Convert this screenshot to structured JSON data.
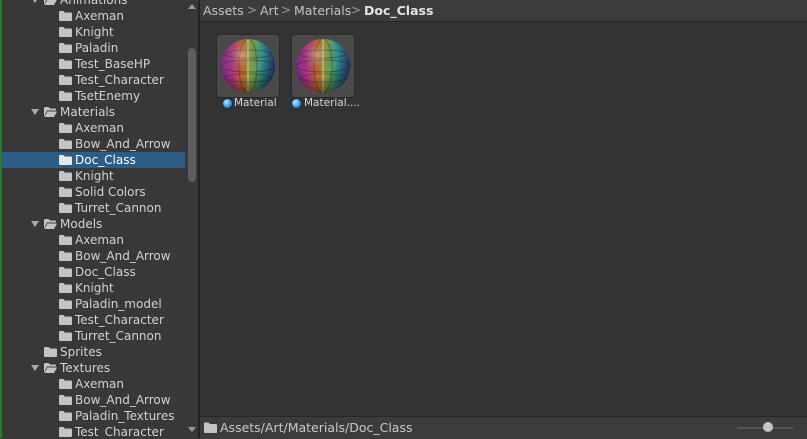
{
  "tree": {
    "rows": [
      {
        "label": "Animations",
        "depth": 0,
        "expanded": true,
        "selected": false
      },
      {
        "label": "Axeman",
        "depth": 1,
        "expanded": false,
        "selected": false
      },
      {
        "label": "Knight",
        "depth": 1,
        "expanded": false,
        "selected": false
      },
      {
        "label": "Paladin",
        "depth": 1,
        "expanded": false,
        "selected": false
      },
      {
        "label": "Test_BaseHP",
        "depth": 1,
        "expanded": false,
        "selected": false
      },
      {
        "label": "Test_Character",
        "depth": 1,
        "expanded": false,
        "selected": false
      },
      {
        "label": "TsetEnemy",
        "depth": 1,
        "expanded": false,
        "selected": false
      },
      {
        "label": "Materials",
        "depth": 0,
        "expanded": true,
        "selected": false
      },
      {
        "label": "Axeman",
        "depth": 1,
        "expanded": false,
        "selected": false
      },
      {
        "label": "Bow_And_Arrow",
        "depth": 1,
        "expanded": false,
        "selected": false
      },
      {
        "label": "Doc_Class",
        "depth": 1,
        "expanded": false,
        "selected": true
      },
      {
        "label": "Knight",
        "depth": 1,
        "expanded": false,
        "selected": false
      },
      {
        "label": "Solid Colors",
        "depth": 1,
        "expanded": false,
        "selected": false
      },
      {
        "label": "Turret_Cannon",
        "depth": 1,
        "expanded": false,
        "selected": false
      },
      {
        "label": "Models",
        "depth": 0,
        "expanded": true,
        "selected": false
      },
      {
        "label": "Axeman",
        "depth": 1,
        "expanded": false,
        "selected": false
      },
      {
        "label": "Bow_And_Arrow",
        "depth": 1,
        "expanded": false,
        "selected": false
      },
      {
        "label": "Doc_Class",
        "depth": 1,
        "expanded": false,
        "selected": false
      },
      {
        "label": "Knight",
        "depth": 1,
        "expanded": false,
        "selected": false
      },
      {
        "label": "Paladin_model",
        "depth": 1,
        "expanded": false,
        "selected": false
      },
      {
        "label": "Test_Character",
        "depth": 1,
        "expanded": false,
        "selected": false
      },
      {
        "label": "Turret_Cannon",
        "depth": 1,
        "expanded": false,
        "selected": false
      },
      {
        "label": "Sprites",
        "depth": 0,
        "expanded": false,
        "selected": false,
        "leaf": true
      },
      {
        "label": "Textures",
        "depth": 0,
        "expanded": true,
        "selected": false
      },
      {
        "label": "Axeman",
        "depth": 1,
        "expanded": false,
        "selected": false
      },
      {
        "label": "Bow_And_Arrow",
        "depth": 1,
        "expanded": false,
        "selected": false
      },
      {
        "label": "Paladin_Textures",
        "depth": 1,
        "expanded": false,
        "selected": false
      },
      {
        "label": "Test_Character",
        "depth": 1,
        "expanded": false,
        "selected": false
      }
    ]
  },
  "breadcrumb": {
    "items": [
      "Assets",
      "Art",
      "Materials",
      "Doc_Class"
    ],
    "separator": ">"
  },
  "assets": [
    {
      "label": "Material",
      "icon": "material-sphere-icon"
    },
    {
      "label": "Material....",
      "icon": "material-sphere-icon"
    }
  ],
  "footer": {
    "path": "Assets/Art/Materials/Doc_Class",
    "zoom_level": 0.5
  },
  "colors": {
    "selection": "#2c5d87",
    "background": "#383838",
    "panel": "#333333"
  }
}
